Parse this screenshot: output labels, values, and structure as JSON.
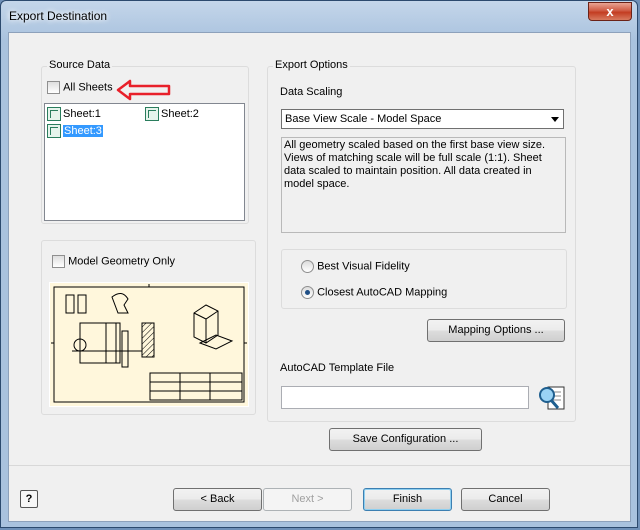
{
  "window": {
    "title": "Export Destination",
    "close_glyph": "x"
  },
  "source_data": {
    "label": "Source Data",
    "all_sheets_label": "All Sheets",
    "sheets": [
      {
        "label": "Sheet:1",
        "selected": false
      },
      {
        "label": "Sheet:2",
        "selected": false
      },
      {
        "label": "Sheet:3",
        "selected": true
      }
    ]
  },
  "model_geometry": {
    "label": "Model Geometry Only"
  },
  "export_options": {
    "label": "Export Options",
    "data_scaling_label": "Data Scaling",
    "data_scaling_value": "Base View Scale - Model Space",
    "description": "All geometry scaled based on the first base view size. Views of matching scale will be full scale (1:1). Sheet data scaled to maintain position. All data created in model space.",
    "radio_options": [
      {
        "label": "Best Visual Fidelity",
        "checked": false
      },
      {
        "label": "Closest AutoCAD Mapping",
        "checked": true
      }
    ],
    "mapping_button": "Mapping Options ...",
    "template_label": "AutoCAD Template File",
    "template_value": ""
  },
  "save_configuration_button": "Save Configuration ...",
  "footer": {
    "help": "?",
    "back": "< Back",
    "next": "Next >",
    "finish": "Finish",
    "cancel": "Cancel"
  },
  "colors": {
    "annotation_arrow": "#e8202a",
    "selection": "#3399ff",
    "preview_paper": "#fff7dc"
  }
}
